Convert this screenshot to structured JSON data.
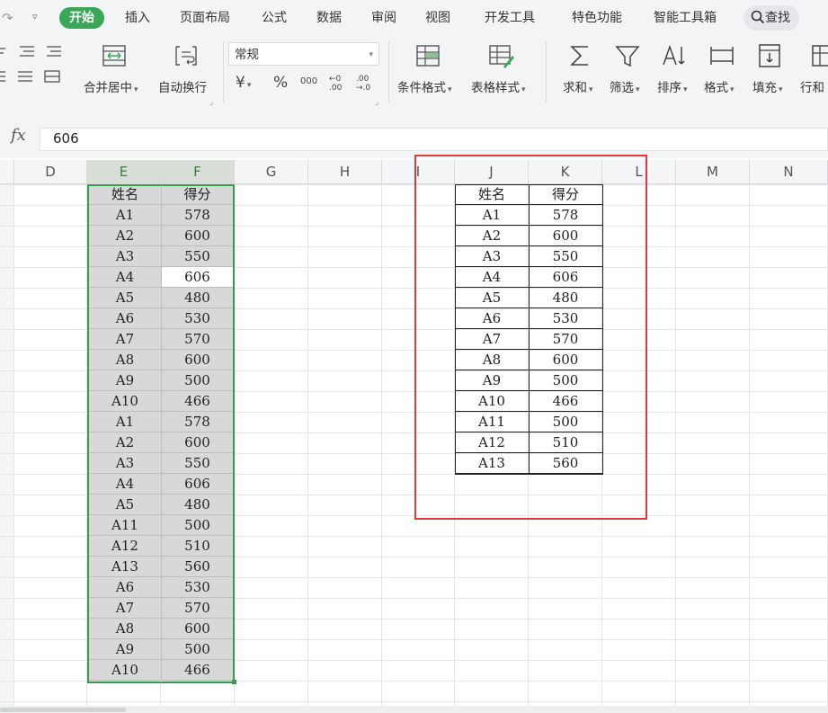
{
  "menu": {
    "active_tab": "开始",
    "items": [
      "插入",
      "页面布局",
      "公式",
      "数据",
      "审阅",
      "视图",
      "开发工具",
      "特色功能",
      "智能工具箱"
    ],
    "search_label": "查找"
  },
  "ribbon": {
    "merge_center": "合并居中",
    "wrap_text": "自动换行",
    "number_format": "常规",
    "currency_symbol": "¥",
    "percent_symbol": "%",
    "thousands_symbol": "000",
    "increase_decimal": "←0 .00",
    "decrease_decimal": ".00 →.0",
    "conditional_format": "条件格式",
    "table_style": "表格样式",
    "sum": "求和",
    "filter": "筛选",
    "sort": "排序",
    "format": "格式",
    "fill": "填充",
    "row_col": "行和"
  },
  "formula_bar": {
    "fx_label": "fx",
    "value": "606"
  },
  "columns": [
    "D",
    "E",
    "F",
    "G",
    "H",
    "I",
    "J",
    "K",
    "L",
    "M",
    "N"
  ],
  "selected_columns": [
    "E",
    "F"
  ],
  "left_table": {
    "headers": [
      "姓名",
      "得分"
    ],
    "rows": [
      [
        "A1",
        "578"
      ],
      [
        "A2",
        "600"
      ],
      [
        "A3",
        "550"
      ],
      [
        "A4",
        "606"
      ],
      [
        "A5",
        "480"
      ],
      [
        "A6",
        "530"
      ],
      [
        "A7",
        "570"
      ],
      [
        "A8",
        "600"
      ],
      [
        "A9",
        "500"
      ],
      [
        "A10",
        "466"
      ],
      [
        "A1",
        "578"
      ],
      [
        "A2",
        "600"
      ],
      [
        "A3",
        "550"
      ],
      [
        "A4",
        "606"
      ],
      [
        "A5",
        "480"
      ],
      [
        "A11",
        "500"
      ],
      [
        "A12",
        "510"
      ],
      [
        "A13",
        "560"
      ],
      [
        "A6",
        "530"
      ],
      [
        "A7",
        "570"
      ],
      [
        "A8",
        "600"
      ],
      [
        "A9",
        "500"
      ],
      [
        "A10",
        "466"
      ]
    ],
    "active_row": 3
  },
  "right_table": {
    "headers": [
      "姓名",
      "得分"
    ],
    "rows": [
      [
        "A1",
        "578"
      ],
      [
        "A2",
        "600"
      ],
      [
        "A3",
        "550"
      ],
      [
        "A4",
        "606"
      ],
      [
        "A5",
        "480"
      ],
      [
        "A6",
        "530"
      ],
      [
        "A7",
        "570"
      ],
      [
        "A8",
        "600"
      ],
      [
        "A9",
        "500"
      ],
      [
        "A10",
        "466"
      ],
      [
        "A11",
        "500"
      ],
      [
        "A12",
        "510"
      ],
      [
        "A13",
        "560"
      ]
    ]
  },
  "colors": {
    "accent_green": "#3aa757",
    "selection_border": "#3c9a4c",
    "highlight_red": "#e23a3a"
  }
}
